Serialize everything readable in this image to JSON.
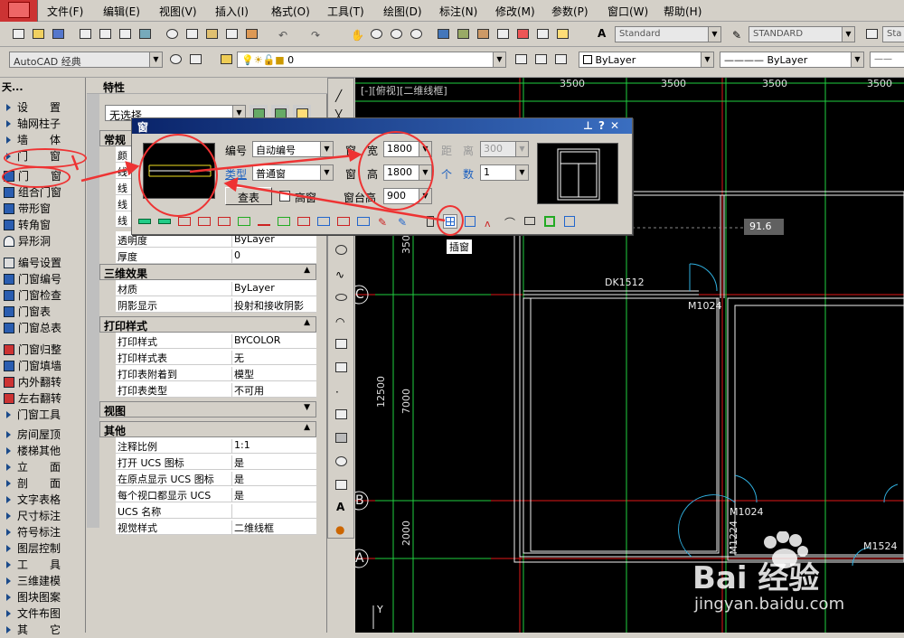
{
  "menu": [
    "文件(F)",
    "编辑(E)",
    "视图(V)",
    "插入(I)",
    "格式(O)",
    "工具(T)",
    "绘图(D)",
    "标注(N)",
    "修改(M)",
    "参数(P)",
    "窗口(W)",
    "帮助(H)"
  ],
  "toolbar": {
    "style1": "Standard",
    "style2": "STANDARD",
    "style3": "Sta",
    "workspace": "AutoCAD 经典",
    "layer": "0",
    "color": "ByLayer",
    "linetype": "ByLayer"
  },
  "left_palette": {
    "title": "天...",
    "items": [
      "设　　置",
      "轴网柱子",
      "墙　　体",
      "门　　窗",
      "门　　窗",
      "组合门窗",
      "带形窗",
      "转角窗",
      "异形洞",
      "编号设置",
      "门窗编号",
      "门窗检查",
      "门窗表",
      "门窗总表",
      "门窗归整",
      "门窗填墙",
      "内外翻转",
      "左右翻转",
      "门窗工具",
      "房间屋顶",
      "楼梯其他",
      "立　　面",
      "剖　　面",
      "文字表格",
      "尺寸标注",
      "符号标注",
      "图层控制",
      "工　　具",
      "三维建模",
      "图块图案",
      "文件布图",
      "其　　它"
    ]
  },
  "properties": {
    "title": "特性",
    "selection": "无选择",
    "sections": {
      "general": "常规",
      "threed": "三维效果",
      "print": "打印样式",
      "view": "视图",
      "other": "其他"
    },
    "general_rows": [
      {
        "k": "颜",
        "v": ""
      },
      {
        "k": "线",
        "v": ""
      },
      {
        "k": "线",
        "v": ""
      },
      {
        "k": "线",
        "v": ""
      },
      {
        "k": "线",
        "v": ""
      },
      {
        "k": "透明度",
        "v": "ByLayer"
      },
      {
        "k": "厚度",
        "v": "0"
      }
    ],
    "threed_rows": [
      {
        "k": "材质",
        "v": "ByLayer"
      },
      {
        "k": "阴影显示",
        "v": "投射和接收阴影"
      }
    ],
    "print_rows": [
      {
        "k": "打印样式",
        "v": "BYCOLOR"
      },
      {
        "k": "打印样式表",
        "v": "无"
      },
      {
        "k": "打印表附着到",
        "v": "模型"
      },
      {
        "k": "打印表类型",
        "v": "不可用"
      }
    ],
    "other_rows": [
      {
        "k": "注释比例",
        "v": "1:1"
      },
      {
        "k": "打开 UCS 图标",
        "v": "是"
      },
      {
        "k": "在原点显示 UCS 图标",
        "v": "是"
      },
      {
        "k": "每个视口都显示 UCS",
        "v": "是"
      },
      {
        "k": "UCS 名称",
        "v": ""
      },
      {
        "k": "视觉样式",
        "v": "二维线框"
      }
    ]
  },
  "canvas": {
    "viewport_label": "[-][俯视][二维线框]",
    "dims_top": [
      "3500",
      "3500",
      "3500",
      "3500"
    ],
    "dims_side": [
      "12500",
      "7000",
      "2000",
      "350"
    ],
    "axis_labels": [
      "C",
      "B",
      "A"
    ],
    "labels": [
      "DK1512",
      "M1024",
      "M1024",
      "M1224",
      "M1524"
    ],
    "readout": "91.6",
    "ucs_y": "Y"
  },
  "dialog": {
    "title": "窗",
    "number_label": "编号",
    "number_value": "自动编号",
    "type_label": "类型",
    "type_value": "普通窗",
    "width_label": "窗　宽",
    "width_value": "1800",
    "height_label": "窗　高",
    "height_value": "1800",
    "sill_label": "窗台高",
    "sill_value": "900",
    "distance_label": "距　离",
    "distance_value": "300",
    "count_label": "个　数",
    "count_value": "1",
    "lookup_button": "查表",
    "high_window": "高窗",
    "tooltip": "插窗"
  },
  "watermark": {
    "brand": "Bai 经验",
    "url": "jingyan.baidu.com"
  }
}
